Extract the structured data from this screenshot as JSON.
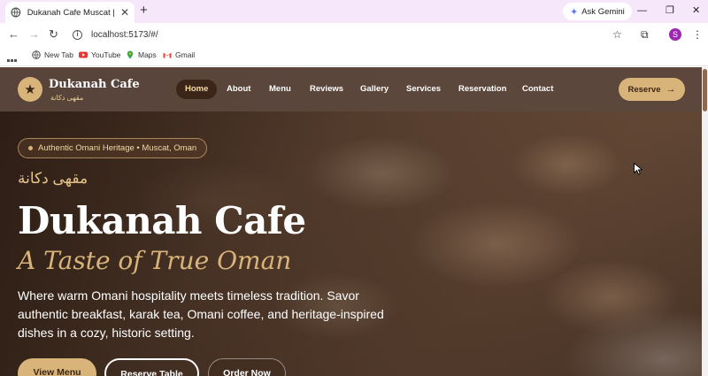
{
  "browser": {
    "tab_title": "Dukanah Cafe Muscat | Authentic Omani Heritage",
    "tab_close": "✕",
    "new_tab": "+",
    "gemini_label": "Ask Gemini",
    "url": "localhost:5173/#/",
    "avatar_letter": "S",
    "bookmarks": [
      "New Tab",
      "YouTube",
      "Maps",
      "Gmail"
    ]
  },
  "site": {
    "logo_name": "Dukanah Cafe",
    "logo_arabic": "مقهى دكانة",
    "nav": [
      "Home",
      "About",
      "Menu",
      "Reviews",
      "Gallery",
      "Services",
      "Reservation",
      "Contact"
    ],
    "reserve_label": "Reserve",
    "reserve_arrow": "→"
  },
  "hero": {
    "pill": "Authentic Omani Heritage • Muscat, Oman",
    "arabic_title": "مقهى دكانة",
    "title": "Dukanah Cafe",
    "subtitle": "A Taste of True Oman",
    "description": "Where warm Omani hospitality meets timeless tradition. Savor authentic breakfast, karak tea, Omani coffee, and heritage-inspired dishes in a cozy, historic setting.",
    "buttons": [
      "View Menu",
      "Reserve Table",
      "Order Now"
    ]
  },
  "colors": {
    "accent_gold": "#d9b47a",
    "nav_bg": "#5c483e",
    "active_nav": "#3b2418",
    "chrome_tab_bar": "#f6e7fa"
  },
  "icons": [
    "globe-icon",
    "back-icon",
    "forward-icon",
    "reload-icon",
    "info-icon",
    "star-icon",
    "cast-icon",
    "menu-dots-icon",
    "apps-grid-icon",
    "star-logo-icon",
    "arrow-right-icon"
  ]
}
